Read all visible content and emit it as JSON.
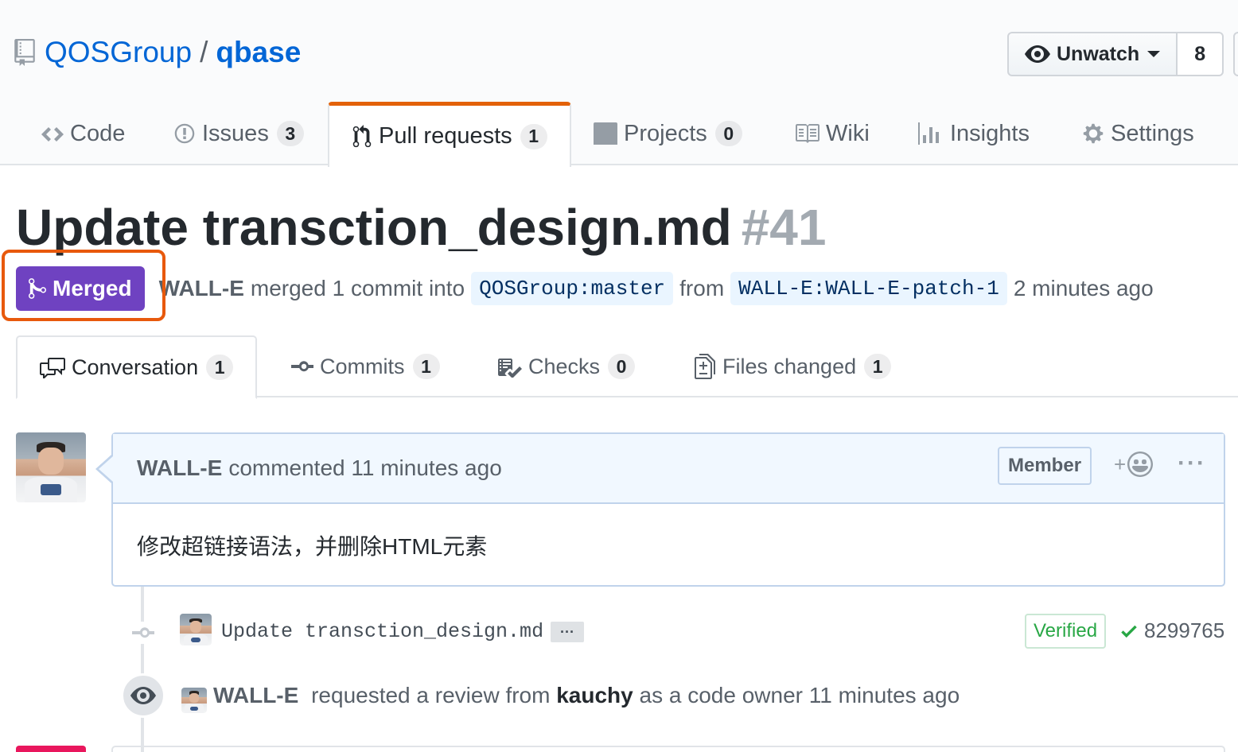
{
  "repo": {
    "owner": "QOSGroup",
    "separator": "/",
    "name": "qbase",
    "watch_label": "Unwatch",
    "watch_count": "8"
  },
  "reponav": {
    "items": [
      {
        "label": "Code",
        "icon": "code-icon"
      },
      {
        "label": "Issues",
        "count": "3",
        "icon": "issue-icon"
      },
      {
        "label": "Pull requests",
        "count": "1",
        "icon": "pull-request-icon",
        "selected": true
      },
      {
        "label": "Projects",
        "count": "0",
        "icon": "project-icon"
      },
      {
        "label": "Wiki",
        "icon": "book-icon"
      },
      {
        "label": "Insights",
        "icon": "graph-icon"
      },
      {
        "label": "Settings",
        "icon": "gear-icon"
      }
    ]
  },
  "pr": {
    "title": "Update transction_design.md",
    "number": "#41",
    "state": "Merged",
    "state_color": "#6f42c1",
    "author": "WALL-E",
    "merged_text": "merged 1 commit into",
    "base_branch": "QOSGroup:master",
    "from_text": "from",
    "head_branch": "WALL-E:WALL-E-patch-1",
    "time": "2 minutes ago"
  },
  "tabs": [
    {
      "label": "Conversation",
      "count": "1",
      "icon": "comment-discussion-icon",
      "selected": true
    },
    {
      "label": "Commits",
      "count": "1",
      "icon": "git-commit-icon"
    },
    {
      "label": "Checks",
      "count": "0",
      "icon": "checklist-icon"
    },
    {
      "label": "Files changed",
      "count": "1",
      "icon": "diff-icon"
    }
  ],
  "comment": {
    "author": "WALL-E",
    "action": "commented 11 minutes ago",
    "role": "Member",
    "reaction_plus": "+",
    "more": "···",
    "body": "修改超链接语法，并删除HTML元素"
  },
  "commit": {
    "message": "Update transction_design.md",
    "ellipsis": "···",
    "verified": "Verified",
    "sha": "8299765"
  },
  "review_event": {
    "author": "WALL-E",
    "text_a": "requested a review from",
    "reviewer": "kauchy",
    "text_b": "as a code owner 11 minutes ago"
  },
  "colors": {
    "link": "#0366d6",
    "merged": "#6f42c1",
    "highlight_outline": "#e8590c",
    "selected_tab_accent": "#e36209",
    "verified": "#28a745"
  }
}
